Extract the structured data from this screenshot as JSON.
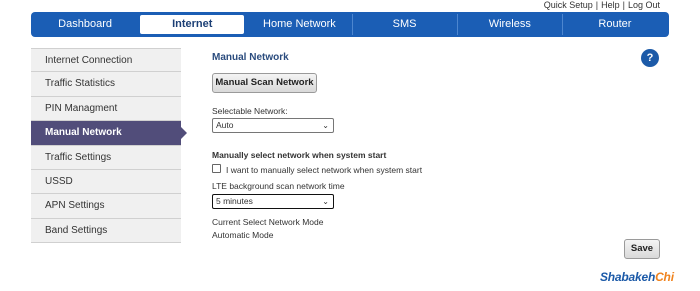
{
  "top_links": {
    "quick_setup": "Quick Setup",
    "help": "Help",
    "logout": "Log Out",
    "separator": "|"
  },
  "nav": {
    "items": [
      "Dashboard",
      "Internet",
      "Home Network",
      "SMS",
      "Wireless",
      "Router"
    ],
    "active": "Internet"
  },
  "sidebar": {
    "items": [
      "Internet Connection",
      "Traffic Statistics",
      "PIN Managment",
      "Manual Network",
      "Traffic Settings",
      "USSD",
      "APN Settings",
      "Band Settings"
    ],
    "active": "Manual Network"
  },
  "main": {
    "title": "Manual Network",
    "scan_button": "Manual Scan Network",
    "selectable_label": "Selectable Network:",
    "selectable_value": "Auto",
    "manual_heading": "Manually select network when system start",
    "checkbox_label": "I want to manually select network when system start",
    "checkbox_checked": false,
    "lte_label": "LTE background scan network time",
    "lte_value": "5 minutes",
    "mode_label": "Current Select Network Mode",
    "mode_value": "Automatic Mode",
    "save_button": "Save"
  },
  "help_icon": "?",
  "logo": {
    "main": "Shabakeh",
    "accent": "Chi",
    "icon": "hexagon-logo-icon"
  },
  "colors": {
    "nav_bg": "#1b5eb5",
    "sidebar_active": "#514d7a",
    "title": "#2b4c7e",
    "accent": "#f0831e"
  }
}
